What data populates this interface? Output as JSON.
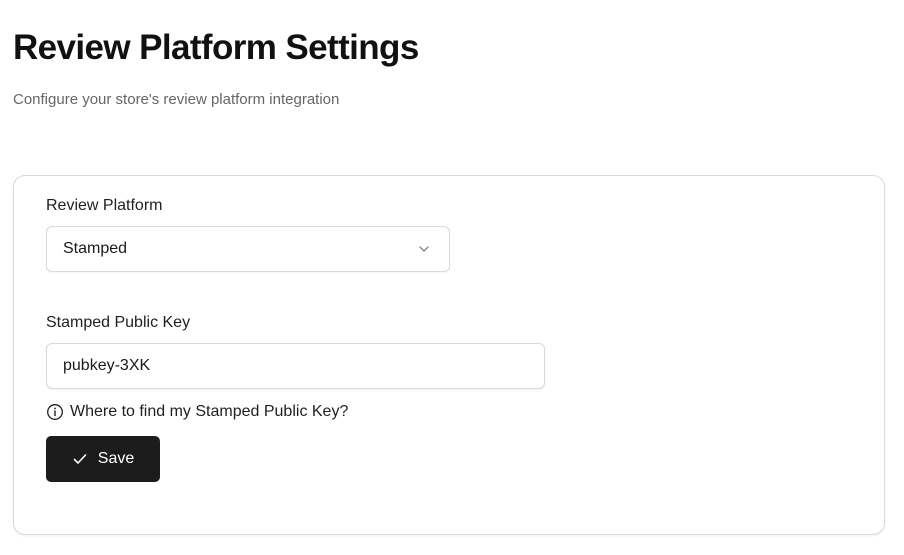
{
  "header": {
    "title": "Review Platform Settings",
    "subtitle": "Configure your store's review platform integration"
  },
  "form": {
    "platform_label": "Review Platform",
    "platform_selected": "Stamped",
    "key_label": "Stamped Public Key",
    "key_value": "pubkey-3XK",
    "help_text": "Where to find my Stamped Public Key?",
    "save_label": "Save"
  },
  "icons": {
    "select_chevron": "chevron-down-icon",
    "help": "info-icon",
    "save": "check-icon"
  },
  "colors": {
    "primary_button": "#1c1c1c",
    "border": "#d9d9d9",
    "muted_text": "#666666"
  }
}
